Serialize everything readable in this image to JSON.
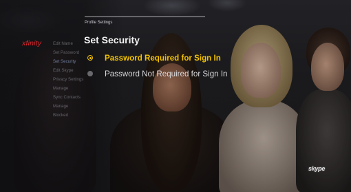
{
  "brand": {
    "logo_text": "xfinity"
  },
  "side_menu": {
    "items": [
      {
        "label": "Edit Name",
        "active": false
      },
      {
        "label": "Set Password",
        "active": false
      },
      {
        "label": "Set Security",
        "active": true
      },
      {
        "label": "Edit Skype",
        "active": false
      },
      {
        "label": "Privacy Settings",
        "active": false
      },
      {
        "label": "Manage",
        "active": false
      },
      {
        "label": "Sync Contacts",
        "active": false
      },
      {
        "label": "Manage",
        "active": false
      },
      {
        "label": "Blocked",
        "active": false
      }
    ]
  },
  "header": {
    "breadcrumb": "Profile Settings"
  },
  "main": {
    "title": "Set Security",
    "options": [
      {
        "label": "Password Required for Sign In",
        "selected": true
      },
      {
        "label": "Password Not Required for Sign In",
        "selected": false
      }
    ]
  },
  "corner_badge": {
    "text": "skype"
  },
  "colors": {
    "accent": "#f2c200",
    "brand_red": "#e5262c"
  }
}
